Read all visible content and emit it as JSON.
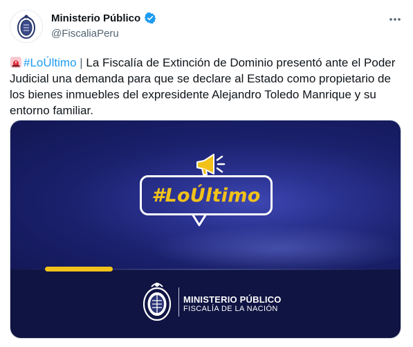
{
  "account": {
    "display_name": "Ministerio Público",
    "handle": "@FiscaliaPeru",
    "avatar_icon": "seal-icon",
    "verified_icon": "verified-badge-icon",
    "verified_color": "#1d9bf0"
  },
  "actions": {
    "more_icon": "more-options-icon"
  },
  "tweet": {
    "emoji_icon": "rotating-light-icon",
    "hashtag": "#LoÚltimo",
    "separator": " | ",
    "text": "La Fiscalía de Extinción de Dominio presentó ante el Poder Judicial una demanda para que se declare al Estado como propietario de los bienes inmuebles del expresidente Alejandro Toledo Manrique y su entorno familiar."
  },
  "media": {
    "bubble_text": "#LoÚltimo",
    "megaphone_icon": "megaphone-icon",
    "logo_title": "MINISTERIO PÚBLICO",
    "logo_subtitle": "FISCALÍA DE LA NACIÓN",
    "colors": {
      "accent_yellow": "#f2c21a",
      "background_dark": "#121653",
      "hashtag_blue": "#1d9bf0"
    }
  }
}
